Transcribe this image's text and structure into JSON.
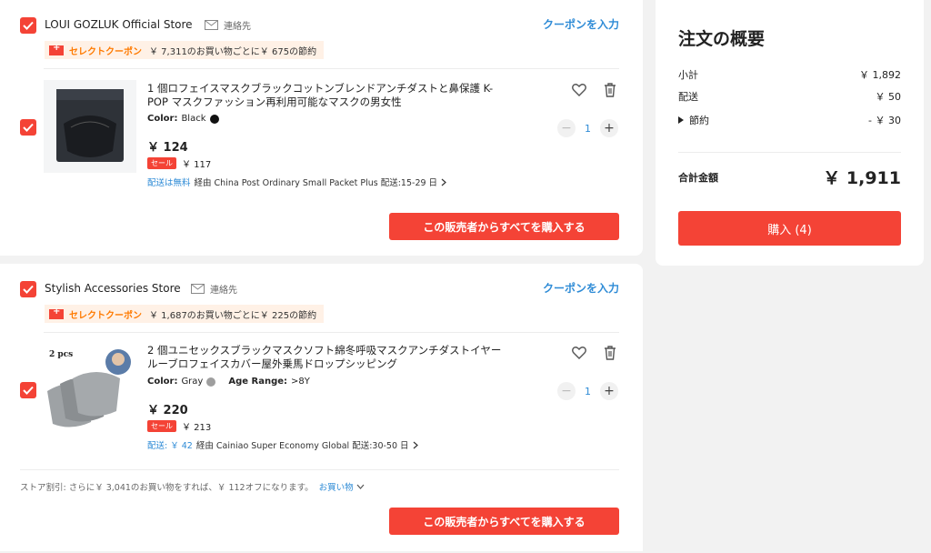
{
  "stores": [
    {
      "name": "LOUI GOZLUK Official Store",
      "contact": "連絡先",
      "coupon_link": "クーポンを入力",
      "select_coupon": {
        "label": "セレクトクーポン",
        "text": "￥ 7,311のお買い物ごとに￥ 675の節約"
      },
      "item": {
        "title": "1 個ロフェイスマスクブラックコットンブレンドアンチダストと鼻保護 K-POP マスクファッション再利用可能なマスクの男女性",
        "color_label": "Color:",
        "color_value": "Black",
        "color_hex": "#111111",
        "price": "￥ 124",
        "sale_tag": "セール",
        "sale_price": "￥ 117",
        "shipping_prefix": "配送は無料",
        "shipping_text": "経由 China Post Ordinary Small Packet Plus  配送:15-29 日",
        "quantity": "1"
      },
      "buy_button": "この販売者からすべてを購入する"
    },
    {
      "name": "Stylish Accessories Store",
      "contact": "連絡先",
      "coupon_link": "クーポンを入力",
      "select_coupon": {
        "label": "セレクトクーポン",
        "text": "￥ 1,687のお買い物ごとに￥ 225の節約"
      },
      "item": {
        "title": "2 個ユニセックスブラックマスクソフト綿冬呼吸マスクアンチダストイヤールーブロフェイスカバー屋外乗馬ドロップシッピング",
        "color_label": "Color:",
        "color_value": "Gray",
        "color_hex": "#9e9e9e",
        "age_label": "Age Range:",
        "age_value": ">8Y",
        "thumb_label": "2 pcs",
        "price": "￥ 220",
        "sale_tag": "セール",
        "sale_price": "￥ 213",
        "shipping_prefix": "配送: ￥ 42",
        "shipping_text": "経由 Cainiao Super Economy Global  配送:30-50 日",
        "quantity": "1"
      },
      "store_discount": "ストア割引: さらに￥ 3,041のお買い物をすれば、￥ 112オフになります。",
      "shop_link": "お買い物",
      "buy_button": "この販売者からすべてを購入する"
    }
  ],
  "summary": {
    "title": "注文の概要",
    "subtotal_label": "小計",
    "subtotal_value": "￥ 1,892",
    "shipping_label": "配送",
    "shipping_value": "￥ 50",
    "savings_label": "節約",
    "savings_value": "- ￥ 30",
    "total_label": "合計金額",
    "total_value": "￥ 1,911",
    "checkout_button": "購入 (4)"
  },
  "colors": {
    "accent": "#f44336",
    "link": "#2e8bd6",
    "coupon_orange": "#ff7a00"
  }
}
